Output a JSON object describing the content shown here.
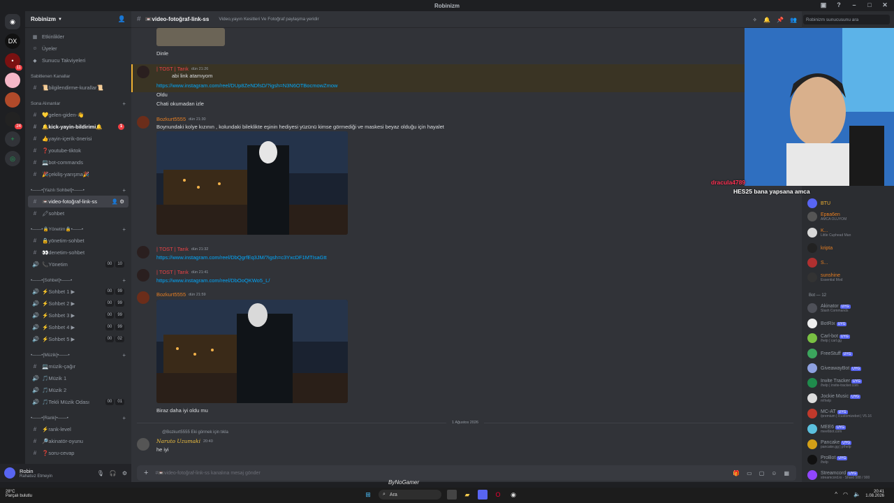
{
  "window": {
    "title": "Robinizm"
  },
  "servers": [
    {
      "label": "DX",
      "badge": ""
    },
    {
      "label": "•",
      "badge": "11"
    },
    {
      "label": "•",
      "badge": ""
    },
    {
      "label": "•",
      "badge": ""
    },
    {
      "label": "•",
      "badge": "24"
    }
  ],
  "sidebar": {
    "server_name": "Robinizm",
    "nav": [
      "Etkinlikler",
      "Üyeler",
      "Sunucu Takviyeleri"
    ],
    "pinned_category": "Sabitlenen Kanallar",
    "pinned": [
      "📜bilgilendirme-kurallar📜"
    ],
    "recent_category": "Sona Alınanlar",
    "recent": [
      "💛gelen-giden-👋",
      "🔔kick-yayin-bildirimi🔔",
      "👍yayin-içerik-önerisi",
      "❓youtube-tiktok",
      "💻bot-commands",
      "🎉çekiliş-yarışma🎉"
    ],
    "chat_category": "•——•[Yazılı Sohbet]•——•",
    "chat": [
      "📼video-fotoğraf-link-ss",
      "🖍sohbet"
    ],
    "admin_category": "•——•🔒Yönetim🔒•——•",
    "admin": [
      "🔒yönetim-sohbet",
      "👀denetim-sohbet",
      "📞Yönetim"
    ],
    "admin_voice_counts": [
      "00",
      "10"
    ],
    "voice_category": "•——•[Sohbet]•——•",
    "voice": [
      "⚡Sohbet 1 ▶",
      "⚡Sohbet 2 ▶",
      "⚡Sohbet 3 ▶",
      "⚡Sohbet 4 ▶",
      "⚡Sohbet 5 ▶"
    ],
    "voice_counts": [
      [
        "00",
        "99"
      ],
      [
        "00",
        "99"
      ],
      [
        "00",
        "99"
      ],
      [
        "00",
        "99"
      ],
      [
        "00",
        "02"
      ]
    ],
    "music_category": "•——•[Müzik]•——•",
    "music": [
      "💻müzik-çağır",
      "🎵Müzik 1",
      "🎵Müzik 2",
      "🎵Tekli Müzik Odası"
    ],
    "music_counts": [
      "00",
      "01"
    ],
    "rank_category": "•——•[Rank]•——•",
    "rank": [
      "⚡rank-level",
      "🔎akinatör-oyunu",
      "❓soru-cevap"
    ]
  },
  "user": {
    "name": "Robin",
    "status": "Rahatsız Etmeyin"
  },
  "channel": {
    "name": "📼video-fotoğraf-link-ss",
    "topic": "Video,yayın Kesitleri Ve Fotoğraf paylaşma yeridir",
    "composer_placeholder": "#📼video-fotoğraf-link-ss kanalına mesaj gönder"
  },
  "search": {
    "placeholder": "Robinizm sunucusunu ara"
  },
  "messages": {
    "m0_line": "Dinle",
    "m1_author": "| TOST | Tarık",
    "m1_time": "dün 21:26",
    "m1_line1": "abi link atamıyom",
    "m1_link": "https://www.instagram.com/reel/DUp8ZeNDfsD/?igsh=N3N6OTBocmowZmow",
    "m1_line2": "Oldu",
    "m1_line3": "Chati okumadan izle",
    "m2_author": "Bozkurt5555",
    "m2_time": "dün 21:30",
    "m2_line": "Boynundaki kolye kızının , kolundaki bileklikte eşinin hediyesi yüzünü kimse görmediği ve maskesi beyaz olduğu için hayalet",
    "m3_author": "| TOST | Tarık",
    "m3_time": "dün 21:32",
    "m3_link": "https://www.instagram.com/reel/DbQgrfEq3JM/?igsh=c3YxcDF1MTIsaGtt",
    "m4_author": "| TOST | Tarık",
    "m4_time": "dün 21:41",
    "m4_link": "https://www.instagram.com/reel/DbOoQKWo5_L/",
    "m5_author": "Bozkurt5555",
    "m5_time": "dün 21:59",
    "m5_line": "Biraz daha iyi oldu mu",
    "date_divider": "1 Ağustos 2026",
    "m6_reply": "@Bozkurt5555 Eki görmek için tıkla",
    "m6_author": "Naruto Uzumaki",
    "m6_time": "20:40",
    "m6_line": "he iyi"
  },
  "stream_overlay": {
    "line1_user": "dracula4789",
    "line2_user": "HES25",
    "line2_text": "bana yapsana amca"
  },
  "members": {
    "online": [
      {
        "name": "BTU",
        "sub": ""
      },
      {
        "name": "Ерва6en",
        "sub": "AMCA OLUYOM"
      },
      {
        "name": "K...",
        "sub": "Little Cuphead Man"
      },
      {
        "name": "kripta",
        "sub": ""
      },
      {
        "name": "S...",
        "sub": ""
      },
      {
        "name": "sunshine",
        "sub": "Essential Mod"
      }
    ],
    "bot_header": "Bot — 12",
    "bots": [
      {
        "name": "Akinator",
        "sub": "Slash Commands"
      },
      {
        "name": "BotRix",
        "sub": ""
      },
      {
        "name": "Carl-bot",
        "sub": "/help | carl.gg"
      },
      {
        "name": "FreeStuff",
        "sub": ""
      },
      {
        "name": "GiveawayBot",
        "sub": ""
      },
      {
        "name": "Invite Tracker",
        "sub": "/help | invite-tracker.com"
      },
      {
        "name": "Jockie Music",
        "sub": "m!help"
      },
      {
        "name": "MC-AT",
        "sub": "/premium | /customizebot | V5.16"
      },
      {
        "name": "MEE6",
        "sub": "mee6bot.com"
      },
      {
        "name": "Pancake",
        "sub": "pancake.gg | p!help"
      },
      {
        "name": "ProBot",
        "sub": "/help"
      },
      {
        "name": "Streamcord",
        "sub": "streamcord.io · Shard 588 / 900"
      }
    ],
    "bot_tag": "UYG"
  },
  "taskbar": {
    "weather_temp": "28°C",
    "weather_text": "Parçalı bulutlu",
    "search": "Ara",
    "time": "20:41",
    "date": "1.08.2026"
  },
  "watermark": "ByNoGamer",
  "colors": {
    "accent": "#5865f2",
    "link": "#00a8fc",
    "highlight": "#f0b232"
  }
}
